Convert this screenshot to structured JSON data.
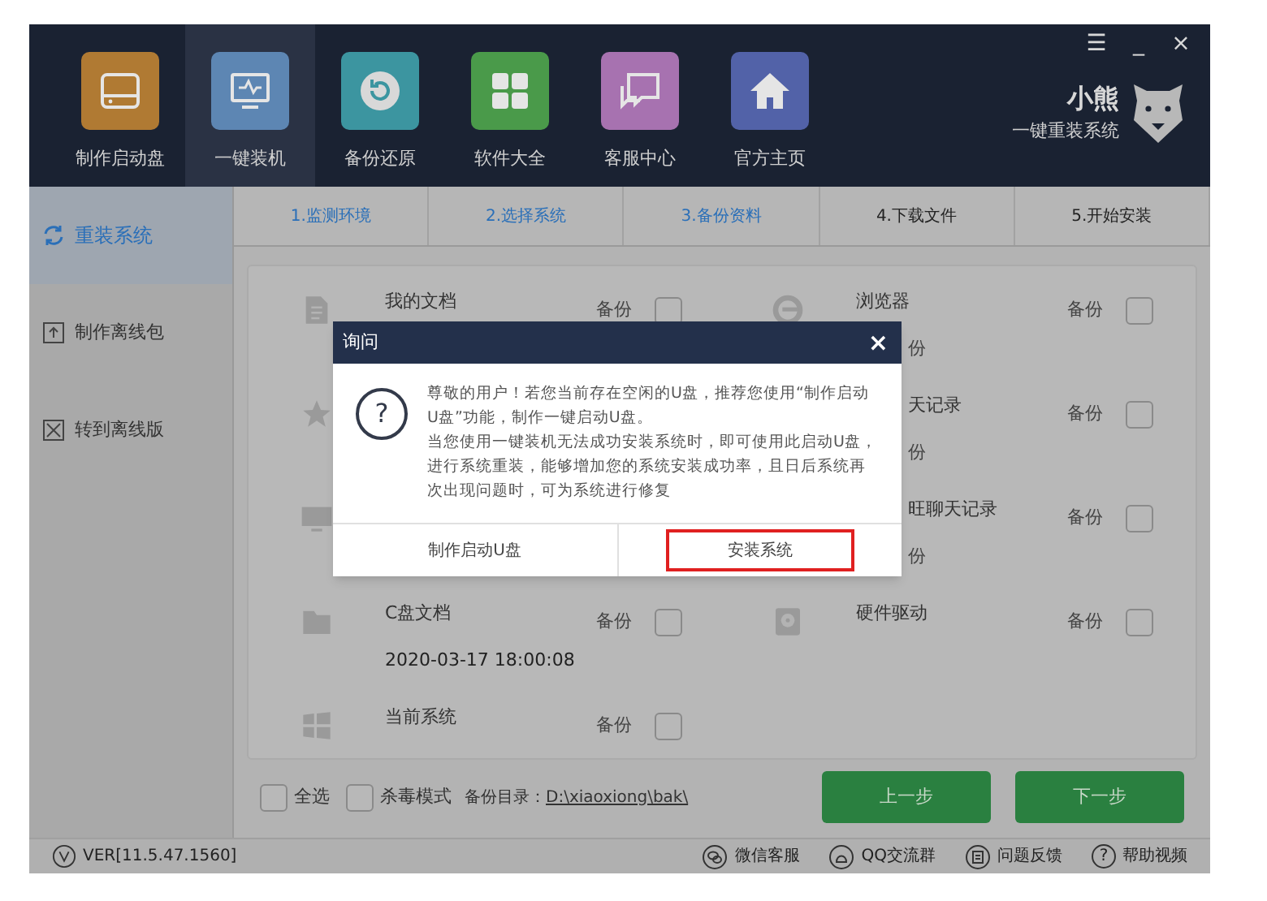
{
  "window_controls": [
    "☰",
    "_",
    "×"
  ],
  "brand": {
    "name": "小熊",
    "tagline": "一键重装系统"
  },
  "nav": [
    {
      "label": "制作启动盘",
      "kind": "drive",
      "color": "#b07a33",
      "selected": false
    },
    {
      "label": "一键装机",
      "kind": "monitor",
      "color": "#5d86b3",
      "selected": true
    },
    {
      "label": "备份还原",
      "kind": "restore",
      "color": "#3c95a0",
      "selected": false
    },
    {
      "label": "软件大全",
      "kind": "grid",
      "color": "#4a9a4a",
      "selected": false
    },
    {
      "label": "客服中心",
      "kind": "chat",
      "color": "#a772b0",
      "selected": false
    },
    {
      "label": "官方主页",
      "kind": "home",
      "color": "#5262a8",
      "selected": false
    }
  ],
  "sidebar": [
    {
      "label": "重装系统",
      "kind": "refresh",
      "selected": true
    },
    {
      "label": "制作离线包",
      "kind": "upload",
      "selected": false
    },
    {
      "label": "转到离线版",
      "kind": "box",
      "selected": false
    }
  ],
  "steps": [
    {
      "label": "1.监测环境",
      "done": true
    },
    {
      "label": "2.选择系统",
      "done": true
    },
    {
      "label": "3.备份资料",
      "done": true
    },
    {
      "label": "4.下载文件",
      "done": false
    },
    {
      "label": "5.开始安装",
      "done": false
    }
  ],
  "backup_left": [
    {
      "kind": "doc",
      "name": "我的文档",
      "backup_label": "备份",
      "checked": false
    },
    {
      "kind": "star"
    },
    {
      "kind": "monitor"
    },
    {
      "kind": "folder",
      "name": "C盘文档",
      "date": "2020-03-17 18:00:08",
      "backup_label": "备份",
      "checked": false
    },
    {
      "kind": "windows",
      "name": "当前系统",
      "backup_label": "备份",
      "checked": false
    }
  ],
  "backup_right": [
    {
      "kind": "browser",
      "name": "浏览器",
      "sub": "份",
      "backup_label": "备份",
      "checked": false
    },
    {
      "kind": "partial",
      "name": "天记录",
      "sub": "份",
      "backup_label": "备份",
      "checked": false
    },
    {
      "kind": "partial",
      "name": "旺聊天记录",
      "sub": "份",
      "backup_label": "备份",
      "checked": false
    },
    {
      "kind": "disk",
      "name": "硬件驱动",
      "backup_label": "备份",
      "checked": false
    }
  ],
  "bottom": {
    "select_all": {
      "label": "全选",
      "checked": false
    },
    "antivirus": {
      "label": "杀毒模式",
      "checked": false
    },
    "dir_label": "备份目录：",
    "dir_path": "D:\\xiaoxiong\\bak\\",
    "prev": "上一步",
    "next": "下一步"
  },
  "footer": {
    "version": "VER[11.5.47.1560]",
    "links": [
      {
        "label": "微信客服",
        "kind": "wechat"
      },
      {
        "label": "QQ交流群",
        "kind": "qq"
      },
      {
        "label": "问题反馈",
        "kind": "feedback"
      },
      {
        "label": "帮助视频",
        "kind": "help",
        "glyph": "?"
      }
    ]
  },
  "dialog": {
    "title": "询问",
    "close": "×",
    "glyph": "?",
    "message_lines": [
      "尊敬的用户！若您当前存在空闲的U盘，推荐您使用“制作启动",
      "U盘”功能，制作一键启动U盘。",
      "当您使用一键装机无法成功安装系统时，即可使用此启动U盘，",
      "进行系统重装，能够增加您的系统安装成功率，且日后系统再",
      "次出现问题时，可为系统进行修复"
    ],
    "buttons": [
      {
        "label": "制作启动U盘",
        "highlighted": false
      },
      {
        "label": "安装系统",
        "highlighted": true
      }
    ]
  }
}
